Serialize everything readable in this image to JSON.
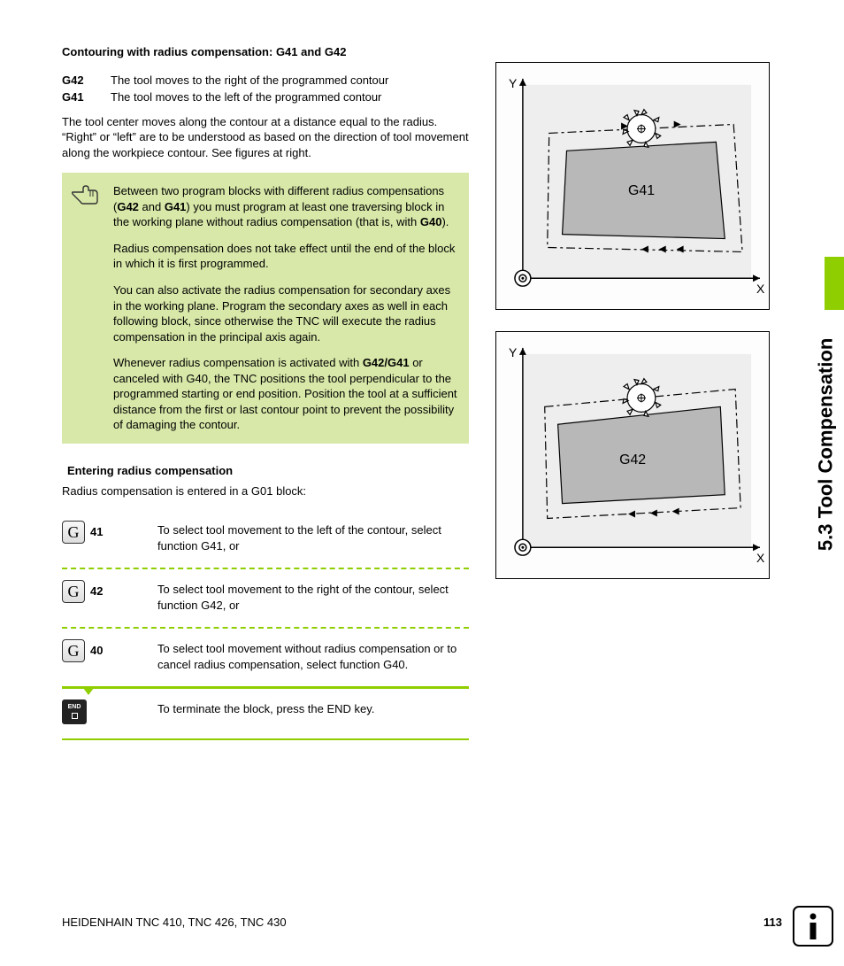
{
  "section_title": "5.3 Tool Compensation",
  "heading": "Contouring with radius compensation: G41 and G42",
  "defs": [
    {
      "term": "G42",
      "desc": "The tool moves to the right of the programmed contour"
    },
    {
      "term": "G41",
      "desc": "The tool moves to the left of the programmed contour"
    }
  ],
  "intro": "The tool center moves along the contour at a distance equal to the radius. “Right” or “left” are to be understood as based on the direction of tool movement along the workpiece contour. See figures at right.",
  "note": {
    "p1a": "Between two program blocks with different radius compensations (",
    "p1b": " and ",
    "p1c": ") you must program at least one traversing block in the working plane without radius compensation (that is, with ",
    "p1d": ").",
    "b1": "G42",
    "b2": "G41",
    "b3": "G40",
    "p2": "Radius compensation does not take effect until the end of the block in which it is first programmed.",
    "p3": "You can also activate the radius compensation for secondary axes in the working plane. Program the secondary axes as well in each following block, since otherwise the TNC will execute the radius compensation in the principal axis again.",
    "p4a": "Whenever radius compensation is activated with ",
    "p4b": " or canceled with G40, the TNC positions the tool perpendicular to the programmed starting or end position. Position the tool at a sufficient distance from the first or last contour point to prevent the possibility of damaging the contour.",
    "b4": "G42/G41"
  },
  "subhead": "Entering radius compensation",
  "subintro": "Radius compensation is entered in a G01 block:",
  "steps": [
    {
      "key": "G",
      "num": "41",
      "text": "To select tool movement to the left of the contour, select function G41, or"
    },
    {
      "key": "G",
      "num": "42",
      "text": "To select tool movement to the right of the contour, select function G42, or"
    },
    {
      "key": "G",
      "num": "40",
      "text": "To select tool movement without radius compensation or to cancel radius compensation, select function G40."
    }
  ],
  "endstep": "To terminate the block, press the END key.",
  "endkey_label": "END",
  "diagrams": {
    "top": {
      "y": "Y",
      "x": "X",
      "label": "G41"
    },
    "bottom": {
      "y": "Y",
      "x": "X",
      "label": "G42"
    }
  },
  "footer_left": "HEIDENHAIN TNC 410, TNC 426, TNC 430",
  "page_number": "113"
}
